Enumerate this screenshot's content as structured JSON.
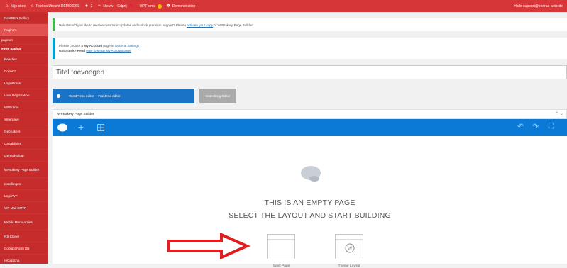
{
  "adminbar": {
    "my_sites": "Mijn sites",
    "site_name": "Pedrao Utrecht DEMO/DSE",
    "comments": "2",
    "new": "Nieuw",
    "gdpr": "Gdprij",
    "wpforms": "WPForms",
    "demonstration": "Demonstration",
    "user": "Hallo support@pedrao-website"
  },
  "sidebar": {
    "items": [
      {
        "label": "NextGEN Gallery"
      },
      {
        "label": "Pagina's"
      },
      {
        "label": "pagina's"
      },
      {
        "label": "euwe pagina"
      },
      {
        "label": "Reacties"
      },
      {
        "label": "Contact"
      },
      {
        "label": "LoginPress"
      },
      {
        "label": "User Registration"
      },
      {
        "label": "WPForms"
      },
      {
        "label": "Weergave"
      },
      {
        "label": "Gebruikers"
      },
      {
        "label": "Capabilities"
      },
      {
        "label": "Gereedschap"
      },
      {
        "label": "WPBakery Page Builder"
      },
      {
        "label": "Instellingen"
      },
      {
        "label": "LoginWP"
      },
      {
        "label": "WP Mail SMTP"
      },
      {
        "label": "Mobile Menu opties"
      },
      {
        "label": "NS Cloner"
      },
      {
        "label": "Contact Form DB"
      },
      {
        "label": "reCaptcha"
      }
    ]
  },
  "notices": {
    "n1_text": "Hola! Would you like to receive automatic updates and unlock premium support? Please",
    "n1_link": "activate your copy",
    "n1_tail": "of WPBakery Page Builder.",
    "n2_line1_pre": "Please choose a",
    "n2_line1_bold": "My Account",
    "n2_line1_mid": "page in",
    "n2_line1_link": "General Settings",
    "n2_line2_pre": "Got Stuck? Read",
    "n2_line2_link": "How to setup My Account page"
  },
  "editor": {
    "title_placeholder": "Titel toevoegen",
    "wp_editor": "WordPress editor",
    "frontend_editor": "Frontend editor",
    "gutenberg": "Gutenberg Editor"
  },
  "page_builder": {
    "header": "WPBakery Page Builder",
    "empty_line1": "THIS IS AN EMPTY PAGE",
    "empty_line2": "SELECT THE LAYOUT AND START BUILDING",
    "templates": [
      {
        "label": "Blank Page"
      },
      {
        "label": "Theme Layout"
      }
    ]
  },
  "colors": {
    "adminbar": "#d63638",
    "sidebar": "#c72c2c",
    "toolbar": "#0a7ad6",
    "arrow": "#e02020"
  }
}
